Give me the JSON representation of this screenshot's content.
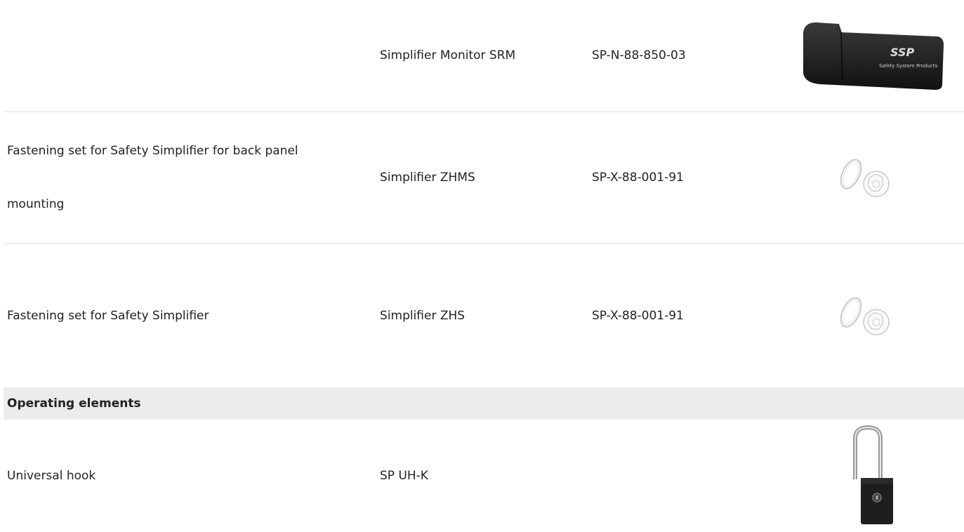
{
  "rows": [
    {
      "description": "",
      "product": "Simplifier Monitor SRM",
      "article": "SP-N-88-850-03",
      "image": "usb-stick-image",
      "logo_text": "SSP",
      "logo_sub": "Safety System Products"
    },
    {
      "description_line1": "Fastening set for Safety Simplifier for back panel",
      "description_line2": "mounting",
      "product": "Simplifier ZHMS",
      "article": "SP-X-88-001-91",
      "image": "fastening-set-image"
    },
    {
      "description": "Fastening set for Safety Simplifier",
      "product": "Simplifier ZHS",
      "article": "SP-X-88-001-91",
      "image": "fastening-set-image"
    }
  ],
  "section": {
    "title": "Operating elements"
  },
  "operating_rows": [
    {
      "description": "Universal hook",
      "product": "SP UH-K",
      "article": "",
      "image": "universal-hook-image"
    }
  ]
}
